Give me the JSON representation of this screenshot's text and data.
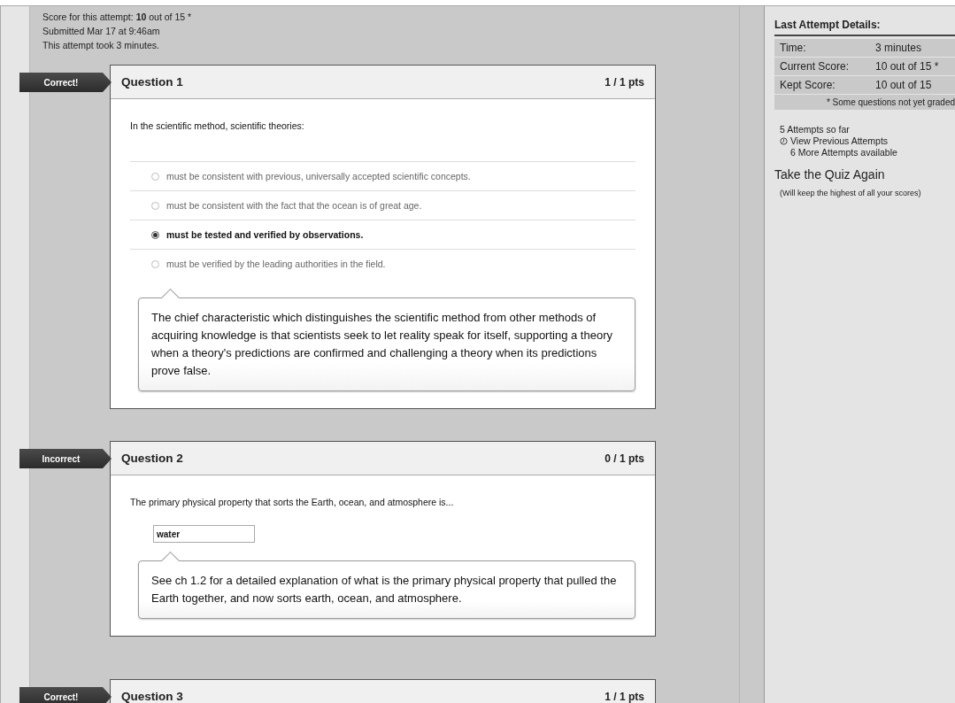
{
  "summary": {
    "score_line": "Score for this attempt: **10** out of 15 *",
    "submitted": "Submitted Mar 17 at 9:46am",
    "duration": "This attempt took 3 minutes."
  },
  "questions": [
    {
      "badge": "Correct!",
      "title": "Question 1",
      "points": "1 / 1 pts",
      "kind": "multiple_choice",
      "prompt": "In the scientific method, scientific theories:",
      "options": [
        {
          "label": "must be consistent with previous, universally accepted scientific concepts.",
          "selected": false
        },
        {
          "label": "must be consistent with the fact that the ocean is of great age.",
          "selected": false
        },
        {
          "label": "must be tested and verified by observations.",
          "selected": true
        },
        {
          "label": "must be verified by the leading authorities in the field.",
          "selected": false
        }
      ],
      "comment": "The chief characteristic which distinguishes the scientific method from other methods of acquiring knowledge is that scientists seek to let reality speak for itself, supporting a theory when a theory's predictions are confirmed and challenging a theory when its predictions prove false."
    },
    {
      "badge": "Incorrect",
      "title": "Question 2",
      "points": "0 / 1 pts",
      "kind": "short_answer",
      "prompt": "The primary physical property that sorts the Earth, ocean, and atmosphere is...",
      "answer": "water",
      "comment": "See ch 1.2 for a detailed explanation of what is the primary physical property that pulled the Earth together, and now sorts earth, ocean, and atmosphere."
    },
    {
      "badge": "Correct!",
      "title": "Question 3",
      "points": "1 / 1 pts",
      "kind": "header_only"
    }
  ],
  "sidebar": {
    "title": "Last Attempt Details:",
    "rows": [
      {
        "label": "Time:",
        "value": "3 minutes"
      },
      {
        "label": "Current Score:",
        "value": "10 out of 15 *"
      },
      {
        "label": "Kept Score:",
        "value": "10 out of 15"
      }
    ],
    "footnote": "* Some questions not yet graded",
    "attempts_count": "5 Attempts so far",
    "view_previous": "View Previous Attempts",
    "more_attempts": "6 More Attempts available",
    "retake": "Take the Quiz Again",
    "retake_note": "(Will keep the highest of all your scores)"
  }
}
